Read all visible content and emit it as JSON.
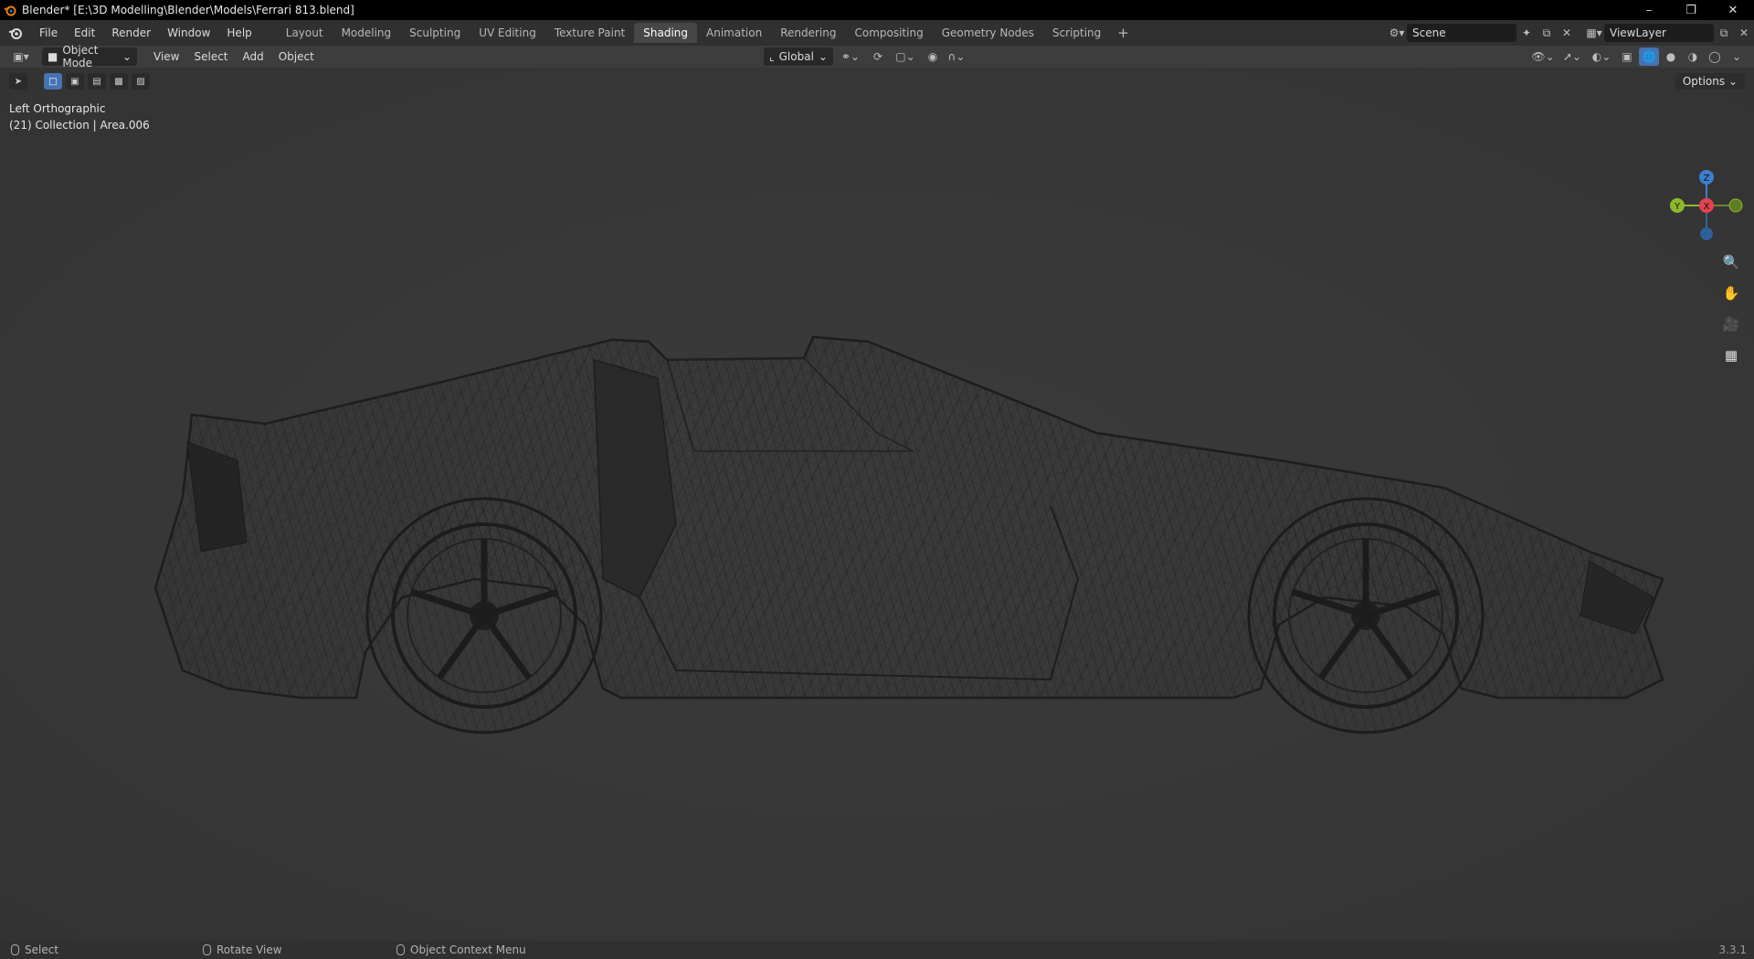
{
  "window": {
    "title": "Blender* [E:\\3D Modelling\\Blender\\Models\\Ferrari 813.blend]",
    "controls": [
      "minimize",
      "restore",
      "close"
    ]
  },
  "menus": [
    "File",
    "Edit",
    "Render",
    "Window",
    "Help"
  ],
  "workspaces": {
    "tabs": [
      "Layout",
      "Modeling",
      "Sculpting",
      "UV Editing",
      "Texture Paint",
      "Shading",
      "Animation",
      "Rendering",
      "Compositing",
      "Geometry Nodes",
      "Scripting"
    ],
    "active": "Shading"
  },
  "scene": {
    "name": "Scene",
    "view_layer": "ViewLayer"
  },
  "viewport_header": {
    "mode": "Object Mode",
    "menus": [
      "View",
      "Select",
      "Add",
      "Object"
    ],
    "transform_orientation": "Global",
    "options_label": "Options"
  },
  "viewport": {
    "view_name": "Left Orthographic",
    "collection_info": "(21) Collection | Area.006",
    "shading": "wireframe",
    "gizmo": {
      "z_label": "Z",
      "y_label": "Y",
      "x_label": "X"
    },
    "accent_color": "#4772b3",
    "axis_colors": {
      "x": "#e5424f",
      "y": "#8cba2c",
      "z": "#3d7fcf"
    }
  },
  "statusbar": {
    "items": [
      "Select",
      "Rotate View",
      "Object Context Menu"
    ],
    "version": "3.3.1"
  }
}
